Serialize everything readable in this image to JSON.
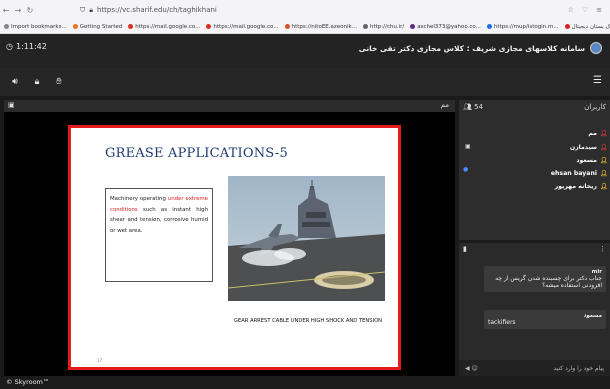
{
  "browser": {
    "url": "https://vc.sharif.edu/ch/taghikhani",
    "bookmarks": [
      {
        "label": "Import bookmarks...",
        "color": "#888888"
      },
      {
        "label": "Getting Started",
        "color": "#e8742c"
      },
      {
        "label": "https://mail.google.co...",
        "color": "#d93025"
      },
      {
        "label": "https://mail.google.co...",
        "color": "#d93025"
      },
      {
        "label": "https://nitoEE.azeonik...",
        "color": "#e04d2e"
      },
      {
        "label": "http://chu.ir/",
        "color": "#666666"
      },
      {
        "label": "aschel373@yahoo.co...",
        "color": "#5b2a86"
      },
      {
        "label": "https://mup/istogin.m...",
        "color": "#1a73e8"
      },
      {
        "label": "قلبه - قارک بستان دیجیتال",
        "color": "#d92020"
      }
    ]
  },
  "app": {
    "timer": "1:11:42",
    "title": "سامانه کلاسهای مجازی شریف : کلاس مجازی دکتر تقی خانی"
  },
  "main": {
    "header_label": "مم"
  },
  "slide": {
    "title": "GREASE APPLICATIONS-5",
    "box_text_1": "Machinery operating ",
    "box_text_red": "under extreme conditions",
    "box_text_2": " such as instant high shear and tension, corrosive humid or wet area.",
    "caption": "GEAR ARREST CABLE UNDER HIGH SHOCK AND TENSION",
    "page_num": "17"
  },
  "users": {
    "title": "کاربران",
    "count": "54",
    "list": [
      {
        "name": "مم",
        "color": "#e23b3b"
      },
      {
        "name": "سیدمازن",
        "color": "#e23b3b"
      },
      {
        "name": "مسعود",
        "color": "#f2c230"
      },
      {
        "name": "ehsan bayani",
        "color": "#f2c230"
      },
      {
        "name": "ریحانه مهرپور",
        "color": "#f2c230"
      }
    ]
  },
  "chat": {
    "messages": [
      {
        "sender": "mir",
        "text": "جناب دکتر برای چسبنده شدن گریس از چه افزودنی استفاده میشه؟"
      },
      {
        "sender": "مسعود",
        "text": "tackifiers"
      }
    ],
    "input_placeholder": "پیام خود را وارد کنید"
  },
  "footer": {
    "brand": "© Skyroom™"
  }
}
